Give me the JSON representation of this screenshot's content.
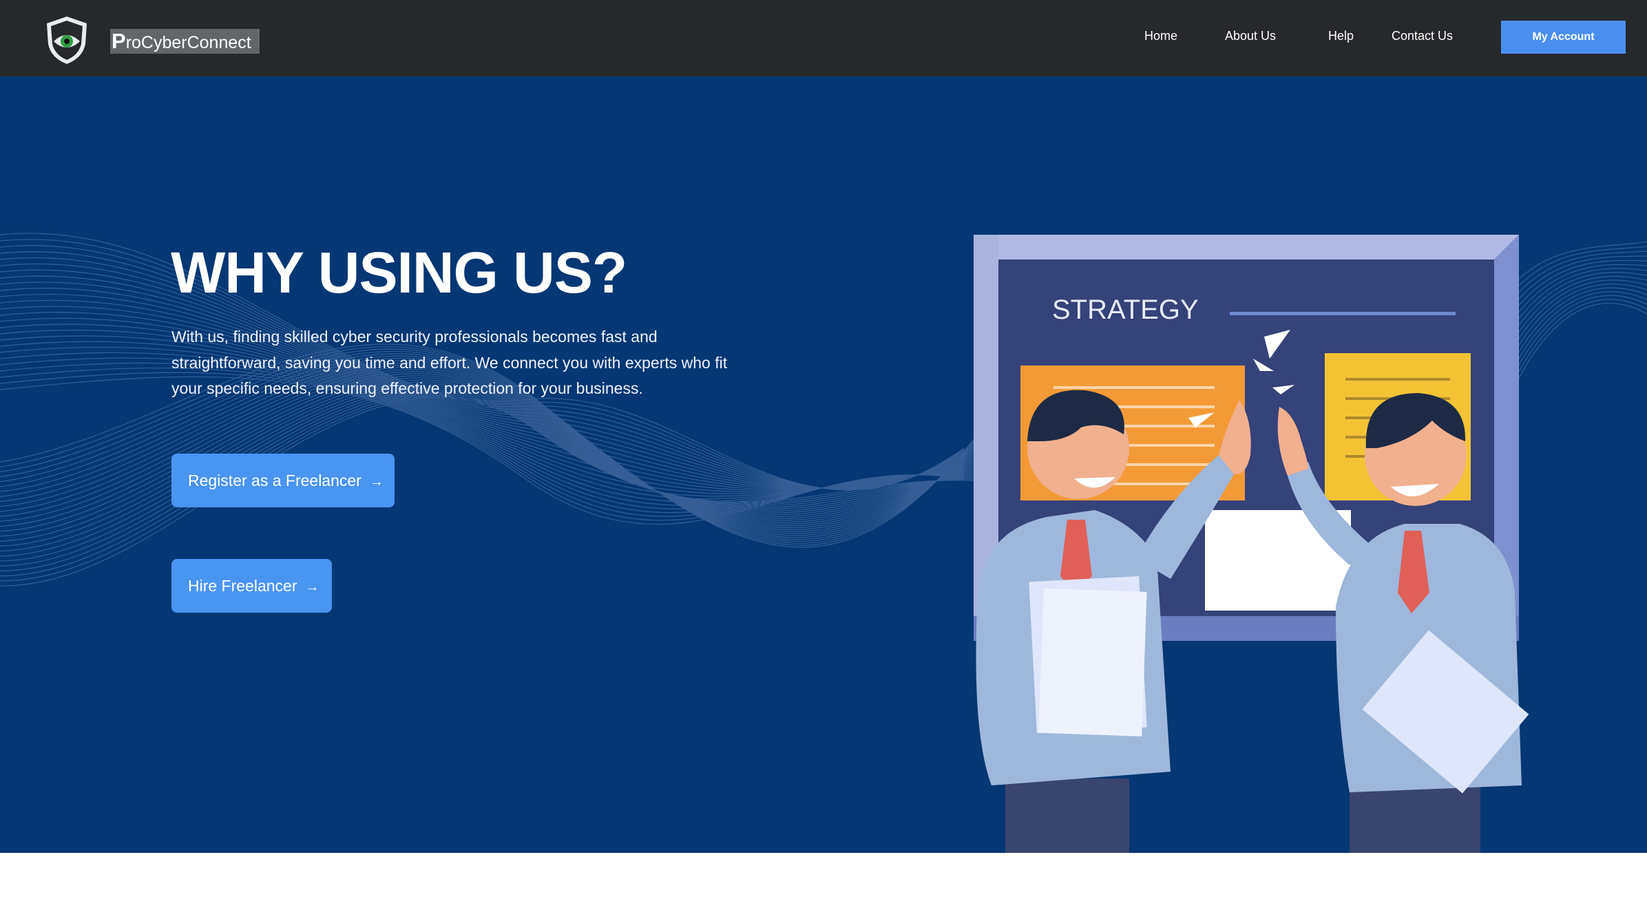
{
  "app": {
    "logo_icon": "eye-shield-icon",
    "brand_initial": "P",
    "brand_rest": "roCyberConnect"
  },
  "nav": {
    "links": [
      "Home",
      "About Us",
      "Help",
      "Contact Us"
    ],
    "account_button": "My Account"
  },
  "hero": {
    "headline": "WHY USING US?",
    "paragraph_lines": [
      "With us, finding skilled cyber security professionals becomes fast and",
      "straightforward, saving you time and effort. We connect you with experts who fit",
      "your specific needs, ensuring effective protection for your business."
    ],
    "buttons": [
      {
        "label": "Register as a Freelancer",
        "icon": "arrow-right-icon"
      },
      {
        "label": "Hire Freelancer",
        "icon": "arrow-right-icon"
      }
    ],
    "illustration": {
      "board_title": "STRATEGY",
      "subject": "two colleagues high-fiving in front of a strategy board"
    }
  },
  "colors": {
    "navbar_bg": "#26282b",
    "hero_bg": "#043773",
    "accent_blue": "#4a8ff0",
    "text_white": "#ffffff"
  }
}
